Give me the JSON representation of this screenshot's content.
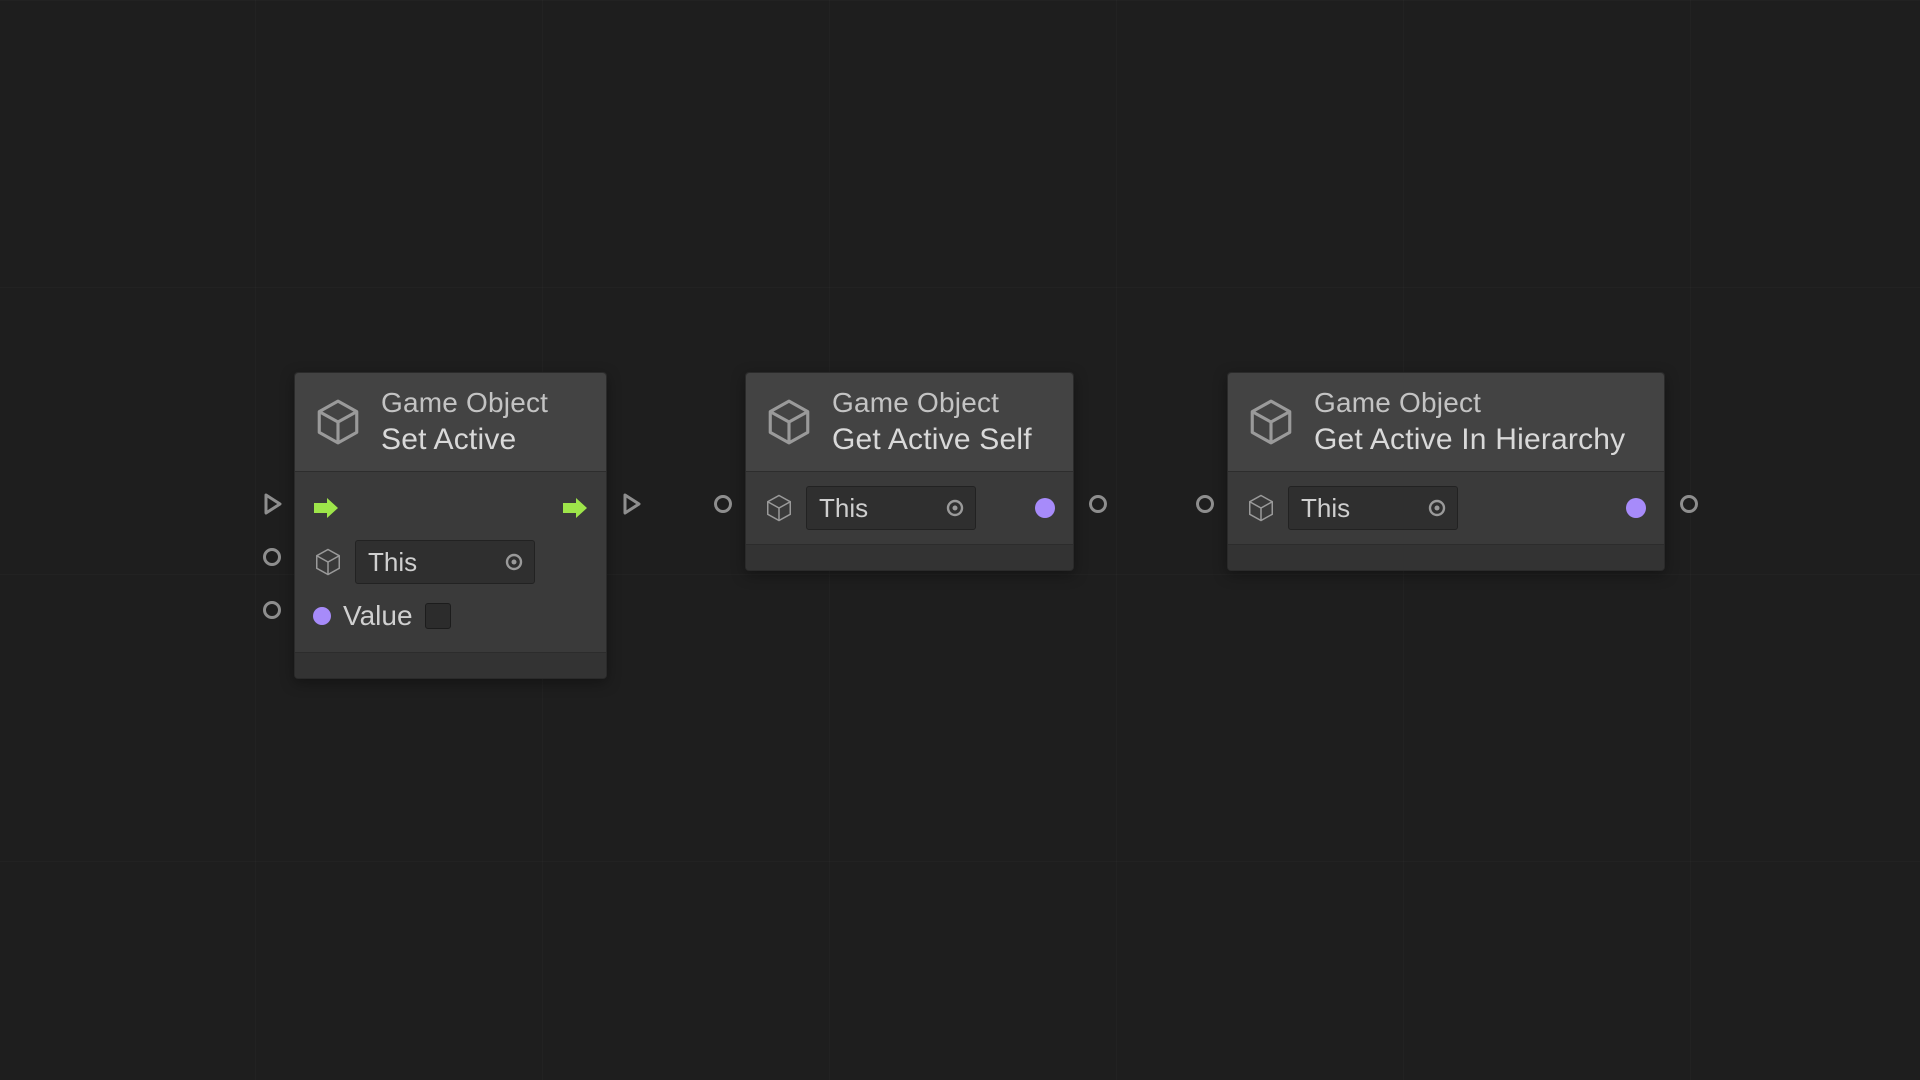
{
  "colors": {
    "flow": "#9ee54a",
    "bool": "#a78bfa"
  },
  "nodes": {
    "setActive": {
      "category": "Game Object",
      "title": "Set Active",
      "targetField": "This",
      "valueLabel": "Value"
    },
    "getActiveSelf": {
      "category": "Game Object",
      "title": "Get Active Self",
      "targetField": "This"
    },
    "getActiveInHierarchy": {
      "category": "Game Object",
      "title": "Get Active In Hierarchy",
      "targetField": "This"
    }
  }
}
